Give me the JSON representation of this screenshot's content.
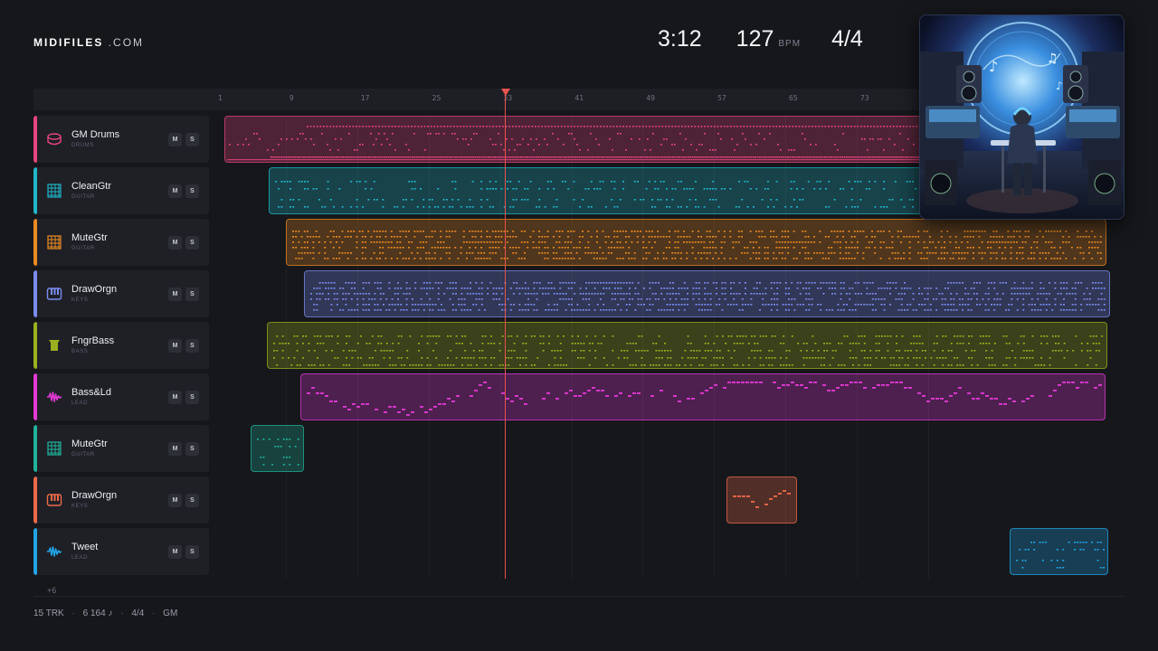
{
  "brand": {
    "bold": "MIDIFILES",
    "rest": ".COM"
  },
  "transport": {
    "time": "3:12",
    "bpm": "127",
    "bpm_unit": "BPM",
    "signature": "4/4"
  },
  "ruler": {
    "ticks": [
      {
        "label": "1",
        "bar": 1
      },
      {
        "label": "9",
        "bar": 9
      },
      {
        "label": "17",
        "bar": 17
      },
      {
        "label": "25",
        "bar": 25
      },
      {
        "label": "33",
        "bar": 33
      },
      {
        "label": "41",
        "bar": 41
      },
      {
        "label": "49",
        "bar": 49
      },
      {
        "label": "57",
        "bar": 57
      },
      {
        "label": "65",
        "bar": 65
      },
      {
        "label": "73",
        "bar": 73
      }
    ]
  },
  "playhead_bar": 33,
  "tracks": [
    {
      "name": "GM Drums",
      "type": "DRUMS",
      "color": "#e6457e",
      "icon": "drum-icon",
      "mute": "M",
      "solo": "S"
    },
    {
      "name": "CleanGtr",
      "type": "GUITAR",
      "color": "#1fb6c8",
      "icon": "guitar-fretboard-icon",
      "mute": "M",
      "solo": "S"
    },
    {
      "name": "MuteGtr",
      "type": "GUITAR",
      "color": "#ea8a22",
      "icon": "guitar-fretboard-icon",
      "mute": "M",
      "solo": "S"
    },
    {
      "name": "DrawOrgn",
      "type": "KEYS",
      "color": "#7b8cf0",
      "icon": "piano-keys-icon",
      "mute": "M",
      "solo": "S"
    },
    {
      "name": "FngrBass",
      "type": "BASS",
      "color": "#9bb01e",
      "icon": "bass-icon",
      "mute": "M",
      "solo": "S"
    },
    {
      "name": "Bass&Ld",
      "type": "LEAD",
      "color": "#e43ad6",
      "icon": "waveform-icon",
      "mute": "M",
      "solo": "S"
    },
    {
      "name": "MuteGtr",
      "type": "GUITAR",
      "color": "#1fb39a",
      "icon": "guitar-fretboard-icon",
      "mute": "M",
      "solo": "S"
    },
    {
      "name": "DrawOrgn",
      "type": "KEYS",
      "color": "#ef6a4a",
      "icon": "piano-keys-icon",
      "mute": "M",
      "solo": "S"
    },
    {
      "name": "Tweet",
      "type": "LEAD",
      "color": "#22a4e6",
      "icon": "waveform-icon",
      "mute": "M",
      "solo": "S"
    }
  ],
  "regions": [
    {
      "track": 0,
      "start_bar": 1.5,
      "end_bar": 80.5,
      "pattern": "drums"
    },
    {
      "track": 1,
      "start_bar": 6.5,
      "end_bar": 80.5,
      "pattern": "sparse"
    },
    {
      "track": 2,
      "start_bar": 8.4,
      "end_bar": 100.4,
      "pattern": "dense"
    },
    {
      "track": 3,
      "start_bar": 10.4,
      "end_bar": 100.8,
      "pattern": "chords"
    },
    {
      "track": 4,
      "start_bar": 6.3,
      "end_bar": 100.5,
      "pattern": "bass"
    },
    {
      "track": 5,
      "start_bar": 10.0,
      "end_bar": 100.3,
      "pattern": "lead"
    },
    {
      "track": 6,
      "start_bar": 4.4,
      "end_bar": 10.4,
      "pattern": "sparse"
    },
    {
      "track": 7,
      "start_bar": 57.8,
      "end_bar": 65.7,
      "pattern": "lead"
    },
    {
      "track": 8,
      "start_bar": 89.5,
      "end_bar": 100.6,
      "pattern": "sparse"
    }
  ],
  "more_tracks": "+6",
  "footer": {
    "tracks": "15 TRK",
    "notes": "6 164 ♪",
    "signature": "4/4",
    "standard": "GM"
  },
  "artwork": {
    "icon": "album-art-studio-image"
  }
}
